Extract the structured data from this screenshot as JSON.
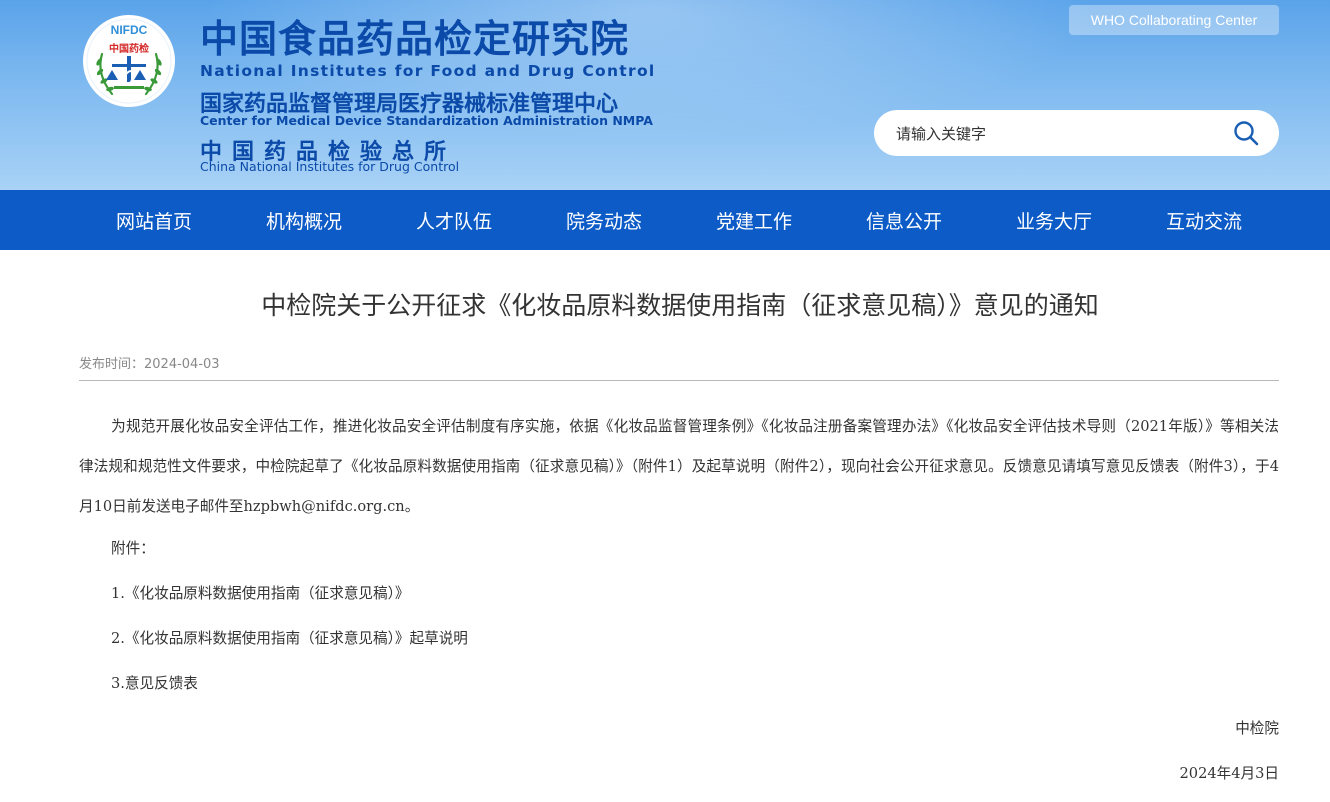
{
  "header": {
    "logo_text_top": "NIFDC",
    "logo_text_mid": "中国药检",
    "title_cn": "中国食品药品检定研究院",
    "title_en": "National Institutes for Food and Drug Control",
    "sub1_cn": "国家药品监督管理局医疗器械标准管理中心",
    "sub1_en": "Center for Medical Device Standardization Administration NMPA",
    "sub2_cn": "中国药品检验总所",
    "sub2_en": "China National Institutes for Drug Control",
    "who_label": "WHO Collaborating Center"
  },
  "search": {
    "placeholder": "请输入关键字",
    "icon": "search-icon"
  },
  "nav": {
    "items": [
      "网站首页",
      "机构概况",
      "人才队伍",
      "院务动态",
      "党建工作",
      "信息公开",
      "业务大厅",
      "互动交流"
    ]
  },
  "article": {
    "title": "中检院关于公开征求《化妆品原料数据使用指南（征求意见稿）》意见的通知",
    "date_label": "发布时间：",
    "date": "2024-04-03",
    "paragraph": "为规范开展化妆品安全评估工作，推进化妆品安全评估制度有序实施，依据《化妆品监督管理条例》《化妆品注册备案管理办法》《化妆品安全评估技术导则（2021年版）》等相关法律法规和规范性文件要求，中检院起草了《化妆品原料数据使用指南（征求意见稿）》（附件1）及起草说明（附件2），现向社会公开征求意见。反馈意见请填写意见反馈表（附件3），于4月10日前发送电子邮件至hzpbwh@nifdc.org.cn。",
    "attachments_label": "附件：",
    "attachments": [
      "1.《化妆品原料数据使用指南（征求意见稿）》",
      "2.《化妆品原料数据使用指南（征求意见稿）》起草说明",
      "3.意见反馈表"
    ],
    "signature": "中检院",
    "sign_date": "2024年4月3日"
  },
  "colors": {
    "nav_bg": "#0d5bc6",
    "header_top": "#5aa3ea",
    "brand_text": "#0b4aa8"
  }
}
